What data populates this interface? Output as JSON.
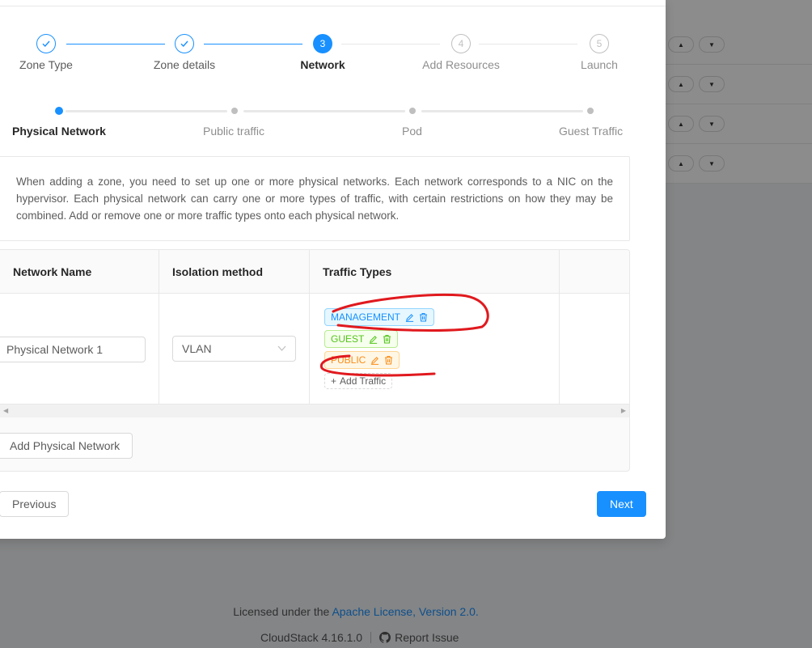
{
  "steps": [
    {
      "label": "Zone Type",
      "status": "done",
      "number": ""
    },
    {
      "label": "Zone details",
      "status": "done",
      "number": ""
    },
    {
      "label": "Network",
      "status": "active",
      "number": "3"
    },
    {
      "label": "Add Resources",
      "status": "wait",
      "number": "4"
    },
    {
      "label": "Launch",
      "status": "wait",
      "number": "5"
    }
  ],
  "substeps": [
    {
      "label": "Physical Network",
      "status": "active"
    },
    {
      "label": "Public traffic",
      "status": "wait"
    },
    {
      "label": "Pod",
      "status": "wait"
    },
    {
      "label": "Guest Traffic",
      "status": "wait"
    }
  ],
  "description": "When adding a zone, you need to set up one or more physical networks. Each network corresponds to a NIC on the hypervisor. Each physical network can carry one or more types of traffic, with certain restrictions on how they may be combined. Add or remove one or more traffic types onto each physical network.",
  "table": {
    "columns": [
      "Network Name",
      "Isolation method",
      "Traffic Types",
      ""
    ],
    "row": {
      "network_name": "Physical Network 1",
      "isolation_method": "VLAN",
      "traffic_types": [
        "MANAGEMENT",
        "GUEST",
        "PUBLIC"
      ],
      "add_traffic_label": "Add Traffic"
    }
  },
  "buttons": {
    "add_physical_network": "Add Physical Network",
    "previous": "Previous",
    "next": "Next"
  },
  "footer": {
    "license_prefix": "Licensed under the",
    "license_link": "Apache License, Version 2.0.",
    "version": "CloudStack 4.16.1.0",
    "report_issue": "Report Issue"
  },
  "colors": {
    "primary": "#1890ff",
    "management_tag": "#1890ff",
    "guest_tag": "#52c41a",
    "public_tag": "#fa8c16",
    "annotation": "#e0191e"
  }
}
